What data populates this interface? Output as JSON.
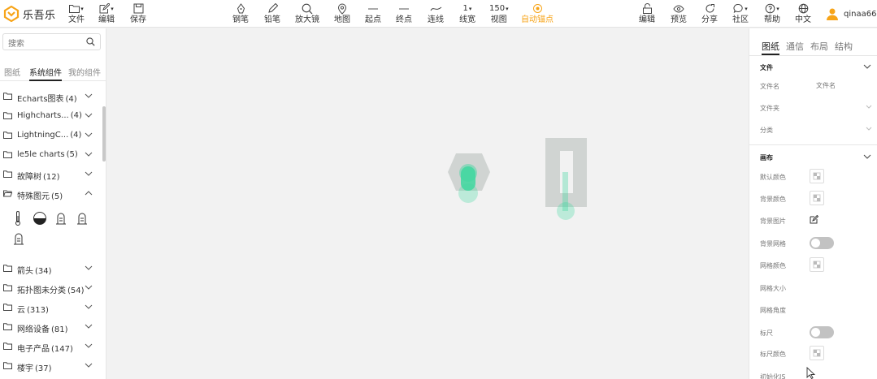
{
  "app": {
    "logo_text": "乐吾乐"
  },
  "header": {
    "file": "文件",
    "edit": "编辑",
    "save": "保存",
    "pen": "钢笔",
    "pencil": "铅笔",
    "magnifier": "放大镜",
    "map": "地图",
    "start_point": "起点",
    "end_point": "终点",
    "connect_line": "连线",
    "line_width_value": "1",
    "line_width": "线宽",
    "zoom_value": "150",
    "view": "视图",
    "auto_anchor": "自动锚点",
    "right_edit": "编辑",
    "preview": "预览",
    "share": "分享",
    "community": "社区",
    "help": "帮助",
    "language": "中文",
    "username": "qinaa66",
    "accent_color": "#f7a418"
  },
  "left": {
    "search_placeholder": "搜索",
    "tabs": [
      "图纸",
      "系统组件",
      "我的组件"
    ],
    "active_tab": "系统组件",
    "categories": [
      {
        "name": "Echarts图表",
        "count": "(4)",
        "expanded": false
      },
      {
        "name": "Highcharts...",
        "count": "(4)",
        "expanded": false
      },
      {
        "name": "LightningC...",
        "count": "(4)",
        "expanded": false
      },
      {
        "name": "le5le charts",
        "count": "(5)",
        "expanded": false
      },
      {
        "name": "故障树",
        "count": "(12)",
        "expanded": false
      },
      {
        "name": "特殊图元",
        "count": "(5)",
        "expanded": true
      },
      {
        "name": "箭头",
        "count": "(34)",
        "expanded": false
      },
      {
        "name": "拓扑图未分类",
        "count": "(54)",
        "expanded": false
      },
      {
        "name": "云",
        "count": "(313)",
        "expanded": false
      },
      {
        "name": "网络设备",
        "count": "(81)",
        "expanded": false
      },
      {
        "name": "电子产品",
        "count": "(147)",
        "expanded": false
      },
      {
        "name": "楼宇",
        "count": "(37)",
        "expanded": false
      }
    ],
    "special_symbols": [
      "thermometer-icon",
      "half-circle-gauge-icon",
      "tank-level-icon",
      "tank-level-icon",
      "tank-level-icon"
    ]
  },
  "canvas": {
    "background": "#f2f2f2",
    "node_color": "#d0d4d2",
    "highlight_color": "#3fd7a0"
  },
  "right": {
    "tabs": [
      "图纸",
      "通信",
      "布局",
      "结构"
    ],
    "active_tab": "图纸",
    "file_section": {
      "title": "文件",
      "name_label": "文件名",
      "name_placeholder": "文件名",
      "folder_label": "文件夹",
      "category_label": "分类"
    },
    "canvas_section": {
      "title": "画布",
      "default_color": "默认颜色",
      "background_color": "背景颜色",
      "background_image": "背景图片",
      "background_grid": "背景网格",
      "background_grid_on": false,
      "grid_color": "网格颜色",
      "grid_size": "网格大小",
      "grid_angle": "网格角度",
      "ruler": "标尺",
      "ruler_on": false,
      "ruler_color": "标尺颜色",
      "init_js": "初始化JS"
    }
  }
}
